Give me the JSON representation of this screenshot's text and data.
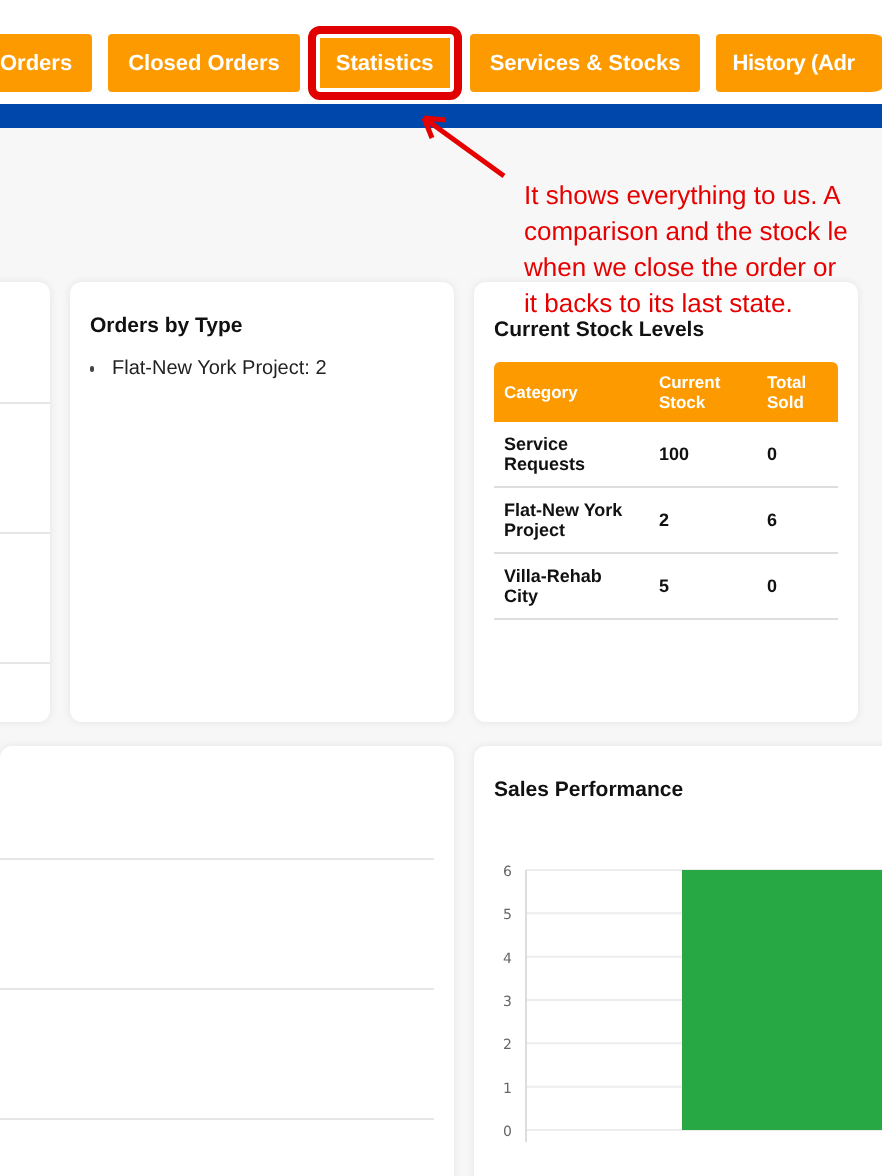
{
  "tabs": [
    {
      "label": "Orders",
      "highlighted": false
    },
    {
      "label": "Closed Orders",
      "highlighted": false
    },
    {
      "label": "Statistics",
      "highlighted": true
    },
    {
      "label": "Services & Stocks",
      "highlighted": false
    },
    {
      "label": "History (Adr",
      "highlighted": false
    }
  ],
  "annotation": {
    "lines": [
      "It shows everything to us. A",
      "comparison and the stock le",
      "when we close the order or",
      "it backs to its last state."
    ]
  },
  "orders_by_type": {
    "title": "Orders by Type",
    "items": [
      "Flat-New York Project: 2"
    ]
  },
  "stock_levels": {
    "title": "Current Stock Levels",
    "columns": [
      "Category",
      "Current Stock",
      "Total Sold"
    ],
    "rows": [
      [
        "Service Requests",
        "100",
        "0"
      ],
      [
        "Flat-New York Project",
        "2",
        "6"
      ],
      [
        "Villa-Rehab City",
        "5",
        "0"
      ]
    ]
  },
  "sales_performance": {
    "title": "Sales Performance",
    "chart_data": {
      "type": "bar",
      "grid": true,
      "ylim": [
        0,
        6
      ],
      "yticks": [
        0,
        1,
        2,
        3,
        4,
        5,
        6
      ],
      "series": [
        {
          "color": "#28a745",
          "values": [
            6
          ]
        }
      ]
    }
  }
}
